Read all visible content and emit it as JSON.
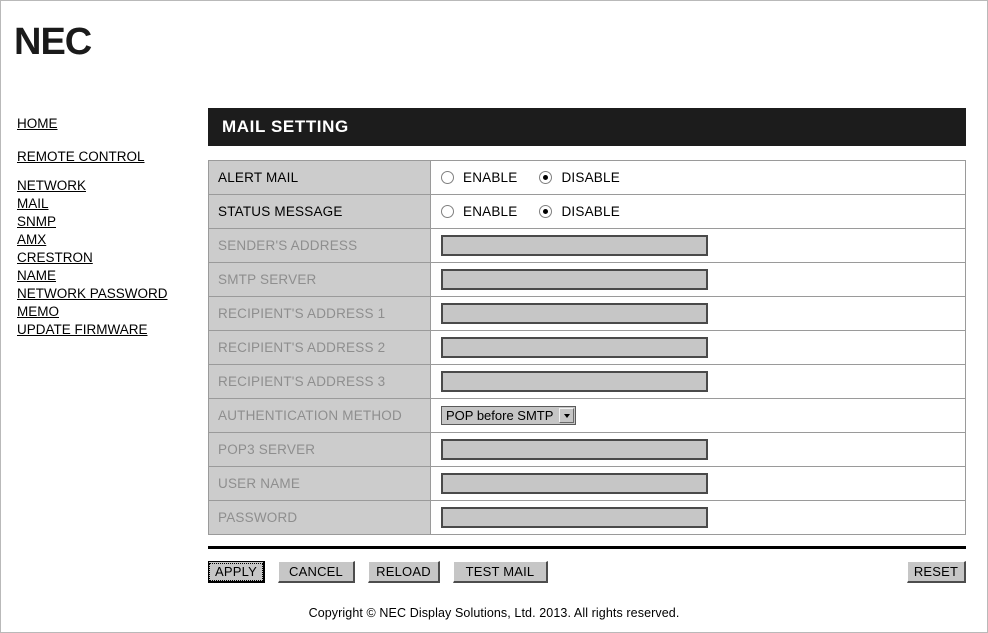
{
  "brand": {
    "logo_text": "NEC"
  },
  "sidebar": {
    "items": [
      {
        "label": "HOME",
        "name": "sidebar-item-home"
      },
      {
        "label": "REMOTE CONTROL",
        "name": "sidebar-item-remote-control"
      },
      {
        "label": "NETWORK",
        "name": "sidebar-item-network"
      },
      {
        "label": "MAIL",
        "name": "sidebar-item-mail"
      },
      {
        "label": "SNMP",
        "name": "sidebar-item-snmp"
      },
      {
        "label": "AMX",
        "name": "sidebar-item-amx"
      },
      {
        "label": "CRESTRON",
        "name": "sidebar-item-crestron"
      },
      {
        "label": "NAME",
        "name": "sidebar-item-name"
      },
      {
        "label": "NETWORK PASSWORD",
        "name": "sidebar-item-network-password"
      },
      {
        "label": "MEMO",
        "name": "sidebar-item-memo"
      },
      {
        "label": "UPDATE FIRMWARE",
        "name": "sidebar-item-update-firmware"
      }
    ]
  },
  "panel": {
    "title": "MAIL SETTING"
  },
  "form": {
    "radio_rows": [
      {
        "label": "ALERT MAIL",
        "options": [
          {
            "label": "ENABLE",
            "selected": false
          },
          {
            "label": "DISABLE",
            "selected": true
          }
        ]
      },
      {
        "label": "STATUS MESSAGE",
        "options": [
          {
            "label": "ENABLE",
            "selected": false
          },
          {
            "label": "DISABLE",
            "selected": true
          }
        ]
      }
    ],
    "text_rows": [
      {
        "label": "SENDER'S ADDRESS",
        "value": "",
        "disabled": true
      },
      {
        "label": "SMTP SERVER",
        "value": "",
        "disabled": true
      },
      {
        "label": "RECIPIENT'S ADDRESS 1",
        "value": "",
        "disabled": true
      },
      {
        "label": "RECIPIENT'S ADDRESS 2",
        "value": "",
        "disabled": true
      },
      {
        "label": "RECIPIENT'S ADDRESS 3",
        "value": "",
        "disabled": true
      }
    ],
    "auth_row": {
      "label": "AUTHENTICATION METHOD",
      "selected": "POP before SMTP",
      "options": [
        "POP before SMTP"
      ]
    },
    "auth_text_rows": [
      {
        "label": "POP3 SERVER",
        "value": "",
        "disabled": true
      },
      {
        "label": "USER NAME",
        "value": "",
        "disabled": true
      },
      {
        "label": "PASSWORD",
        "value": "",
        "disabled": true
      }
    ]
  },
  "buttons": {
    "apply": "APPLY",
    "cancel": "CANCEL",
    "reload": "RELOAD",
    "test_mail": "TEST MAIL",
    "reset": "RESET"
  },
  "footer": {
    "copyright": "Copyright © NEC Display Solutions, Ltd. 2013. All rights reserved."
  }
}
